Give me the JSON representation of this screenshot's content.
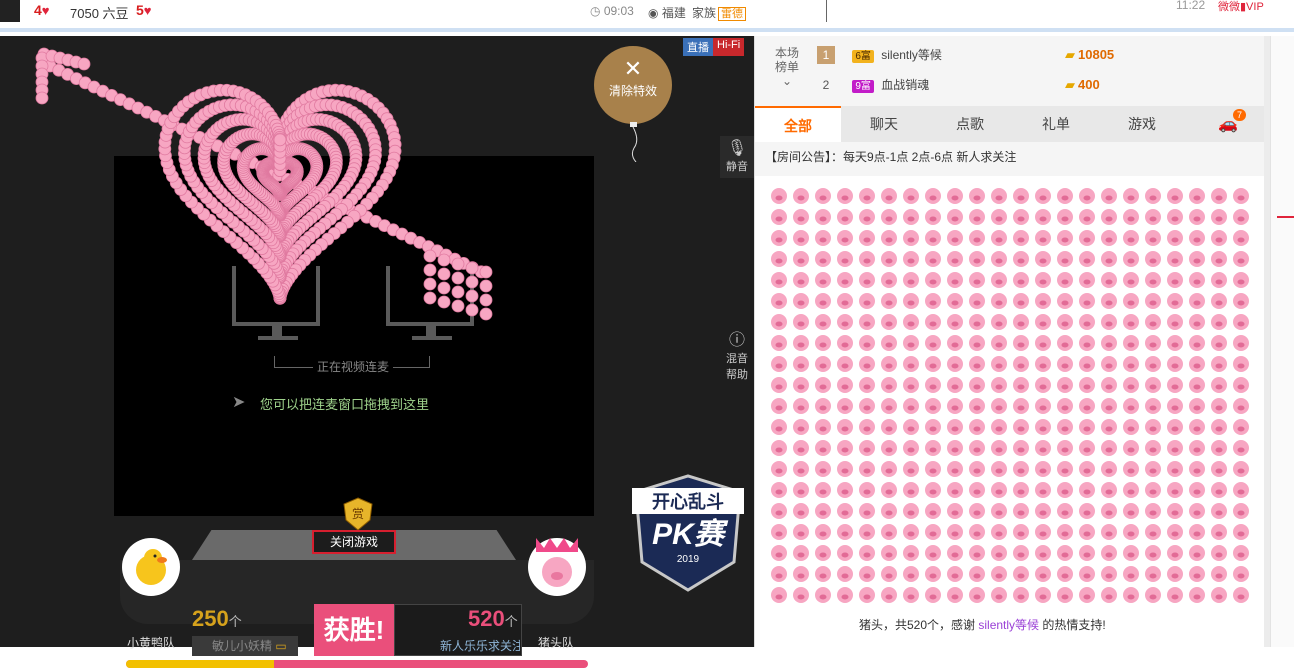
{
  "topbar": {
    "level_a": "4",
    "beans": "7050 六豆",
    "level_b": "5",
    "time": "09:03",
    "location": "福建",
    "family": "家族",
    "family_tag": "雷德",
    "clock": "11:22",
    "vip": "微微▮VIP",
    "avatar_icon": "avatar"
  },
  "video": {
    "tag_live": "直播",
    "tag_hifi": "Hi-Fi",
    "clear_effects": "清除特效",
    "mute": "静音",
    "mix_help_1": "混音",
    "mix_help_2": "帮助",
    "linking": "正在视频连麦",
    "drag_tip": "您可以把连麦窗口拖拽到这里"
  },
  "pk": {
    "close_game": "关闭游戏",
    "shield_text": "赏",
    "team_a": "小黄鸭队",
    "team_b": "猪头队",
    "score_a": "250",
    "score_b": "520",
    "unit": "个",
    "user_a": "敏儿小妖精",
    "user_b": "新人乐乐求关注",
    "win": "获胜!",
    "team_a_share": 0.32,
    "logo_top": "开心乱斗",
    "logo_mid": "PK赛",
    "logo_year": "2019"
  },
  "ranking": {
    "label_1": "本场",
    "label_2": "榜单",
    "rows": [
      {
        "rank": "1",
        "badge": "6富",
        "name": "silently等候",
        "score": "10805"
      },
      {
        "rank": "2",
        "badge": "9富",
        "name": "血战销魂",
        "score": "400"
      }
    ]
  },
  "tabs": [
    {
      "label": "全部"
    },
    {
      "label": "聊天"
    },
    {
      "label": "点歌"
    },
    {
      "label": "礼单"
    },
    {
      "label": "游戏"
    }
  ],
  "car_count": "7",
  "notice": "【房间公告】：每天9点-1点 2点-6点 新人求关注",
  "chat": {
    "msg_pre": "猪头，共520个，感谢",
    "msg_user": "silently等候",
    "msg_post": "的热情支持!"
  },
  "colors": {
    "accent": "#ff6a00",
    "pink": "#ea4f7b",
    "gold": "#d6a21c"
  }
}
